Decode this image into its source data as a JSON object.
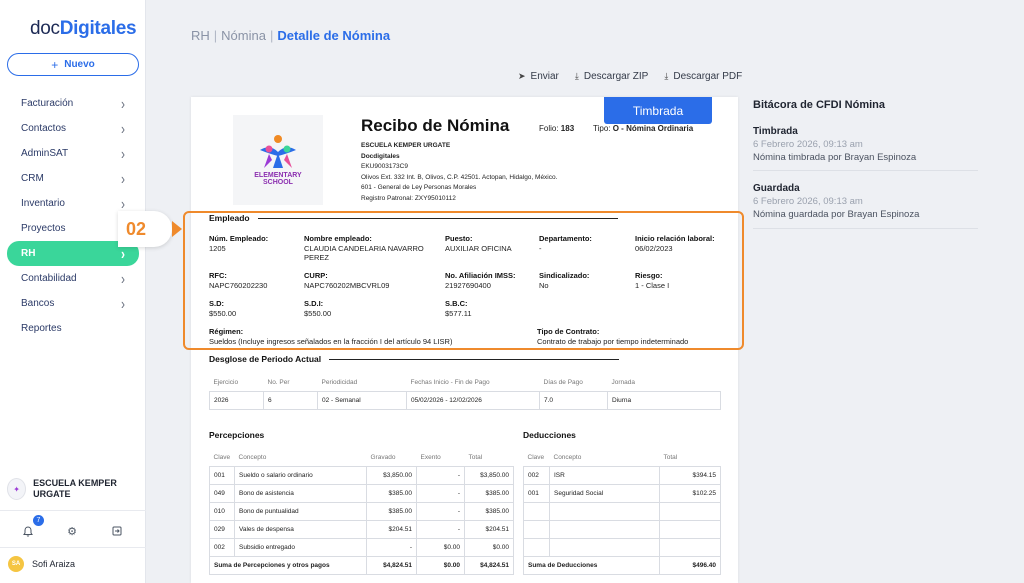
{
  "sidebar": {
    "logo_prefix": "doc",
    "logo_brand": "Digitales",
    "new_button": "Nuevo",
    "items": [
      {
        "label": "Facturación",
        "chevron": true
      },
      {
        "label": "Contactos",
        "chevron": true
      },
      {
        "label": "AdminSAT",
        "chevron": true
      },
      {
        "label": "CRM",
        "chevron": true
      },
      {
        "label": "Inventario",
        "chevron": true
      },
      {
        "label": "Proyectos",
        "chevron": false
      },
      {
        "label": "RH",
        "chevron": true,
        "active": true
      },
      {
        "label": "Contabilidad",
        "chevron": true
      },
      {
        "label": "Bancos",
        "chevron": true
      },
      {
        "label": "Reportes",
        "chevron": false
      }
    ],
    "company_name": "ESCUELA KEMPER URGATE",
    "notifications_count": "7",
    "user_initials": "SA",
    "user_name": "Sofi Araiza"
  },
  "breadcrumb": [
    "RH",
    "Nómina",
    "Detalle de Nómina"
  ],
  "actions": {
    "send": "Enviar",
    "zip": "Descargar ZIP",
    "pdf": "Descargar PDF"
  },
  "receipt": {
    "status_button": "Timbrada",
    "logo_line1": "ELEMENTARY",
    "logo_line2": "SCHOOL",
    "title": "Recibo de Nómina",
    "folio_label": "Folio:",
    "folio": "183",
    "tipo_label": "Tipo:",
    "tipo": "O - Nómina Ordinaria",
    "emisor": {
      "name": "ESCUELA KEMPER URGATE",
      "brand": "Docdigitales",
      "rfc": "EKU9003173C9",
      "address": "Olivos Ext. 332 Int. B, Olivos, C.P. 42501. Actopan, Hidalgo, México.",
      "regimen": "601 - General de Ley Personas Morales",
      "registro": "Registro Patronal: ZXY95010112"
    },
    "employee_section": "Empleado",
    "employee": {
      "num_label": "Núm. Empleado:",
      "num": "1205",
      "name_label": "Nombre empleado:",
      "name": "CLAUDIA CANDELARIA NAVARRO PEREZ",
      "puesto_label": "Puesto:",
      "puesto": "AUXILIAR OFICINA",
      "depto_label": "Departamento:",
      "depto": "-",
      "inicio_label": "Inicio relación laboral:",
      "inicio": "06/02/2023",
      "rfc_label": "RFC:",
      "rfc": "NAPC760202230",
      "curp_label": "CURP:",
      "curp": "NAPC760202MBCVRL09",
      "imss_label": "No. Afiliación IMSS:",
      "imss": "21927690400",
      "sind_label": "Sindicalizado:",
      "sind": "No",
      "riesgo_label": "Riesgo:",
      "riesgo": "1 - Clase I",
      "sd_label": "S.D:",
      "sd": "$550.00",
      "sdi_label": "S.D.I:",
      "sdi": "$550.00",
      "sbc_label": "S.B.C:",
      "sbc": "$577.11",
      "regimen_label": "Régimen:",
      "regimen": "Sueldos (Incluye ingresos señalados en la fracción I del artículo 94 LISR)",
      "contrato_label": "Tipo de Contrato:",
      "contrato": "Contrato de trabajo por tiempo indeterminado"
    },
    "period_section": "Desglose de Periodo Actual",
    "period_headers": [
      "Ejercicio",
      "No. Per",
      "Periodicidad",
      "Fechas Inicio - Fin de Pago",
      "Días de Pago",
      "Jornada"
    ],
    "period_row": [
      "2026",
      "6",
      "02 - Semanal",
      "05/02/2026 - 12/02/2026",
      "7.0",
      "Diurna"
    ],
    "perc_section": "Percepciones",
    "perc_headers": [
      "Clave",
      "Concepto",
      "Gravado",
      "Exento",
      "Total"
    ],
    "perc_rows": [
      [
        "001",
        "Sueldo o salario ordinario",
        "$3,850.00",
        "-",
        "$3,850.00"
      ],
      [
        "049",
        "Bono de asistencia",
        "$385.00",
        "-",
        "$385.00"
      ],
      [
        "010",
        "Bono de puntualidad",
        "$385.00",
        "-",
        "$385.00"
      ],
      [
        "029",
        "Vales de despensa",
        "$204.51",
        "-",
        "$204.51"
      ],
      [
        "002",
        "Subsidio entregado",
        "-",
        "$0.00",
        "$0.00"
      ]
    ],
    "perc_total": [
      "Suma de Percepciones y otros pagos",
      "$4,824.51",
      "$0.00",
      "$4,824.51"
    ],
    "ded_section": "Deducciones",
    "ded_headers": [
      "Clave",
      "Concepto",
      "Total"
    ],
    "ded_rows": [
      [
        "002",
        "ISR",
        "$394.15"
      ],
      [
        "001",
        "Seguridad Social",
        "$102.25"
      ]
    ],
    "ded_total": [
      "Suma de Deducciones",
      "$496.40"
    ]
  },
  "step_label": "02",
  "bitacora": {
    "title": "Bitácora de CFDI Nómina",
    "entries": [
      {
        "status": "Timbrada",
        "date": "6 Febrero 2026, 09:13 am",
        "desc": "Nómina timbrada por Brayan Espinoza"
      },
      {
        "status": "Guardada",
        "date": "6 Febrero 2026, 09:13 am",
        "desc": "Nómina guardada por Brayan Espinoza"
      }
    ]
  },
  "colors": {
    "accent": "#2b6de8",
    "active_nav": "#3ad69a",
    "highlight": "#ef8a2c"
  }
}
